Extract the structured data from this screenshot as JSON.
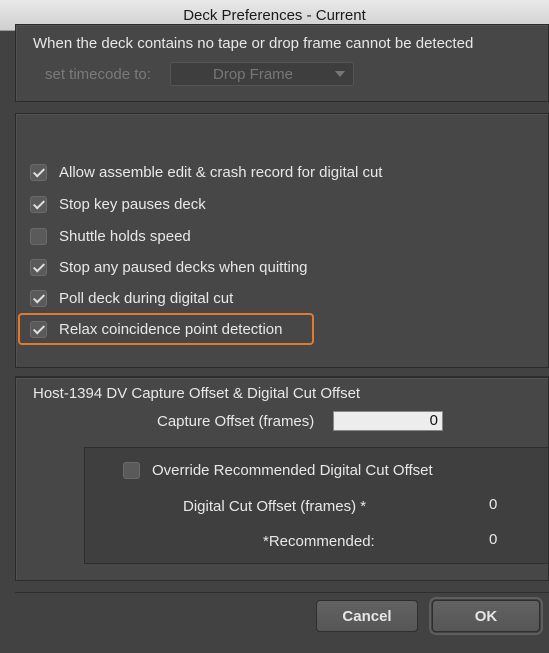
{
  "window": {
    "title": "Deck Preferences - Current"
  },
  "no_tape": {
    "heading": "When the deck contains no tape or drop frame cannot be detected",
    "set_label": "set timecode to:",
    "select_value": "Drop Frame"
  },
  "options": [
    {
      "label": "Allow assemble edit & crash record for digital cut",
      "checked": true
    },
    {
      "label": "Stop key pauses deck",
      "checked": true
    },
    {
      "label": "Shuttle holds speed",
      "checked": false
    },
    {
      "label": "Stop any paused decks when quitting",
      "checked": true
    },
    {
      "label": "Poll deck during digital cut",
      "checked": true
    },
    {
      "label": "Relax coincidence point detection",
      "checked": true
    }
  ],
  "highlight_color": "#e07a2e",
  "offset": {
    "heading": "Host-1394 DV Capture Offset & Digital Cut Offset",
    "capture_label": "Capture Offset (frames)",
    "capture_value": "0",
    "override_label": "Override Recommended Digital Cut Offset",
    "override_checked": false,
    "digital_cut_label": "Digital Cut Offset (frames) *",
    "digital_cut_value": "0",
    "recommended_label": "*Recommended:",
    "recommended_value": "0"
  },
  "buttons": {
    "cancel": "Cancel",
    "ok": "OK"
  }
}
